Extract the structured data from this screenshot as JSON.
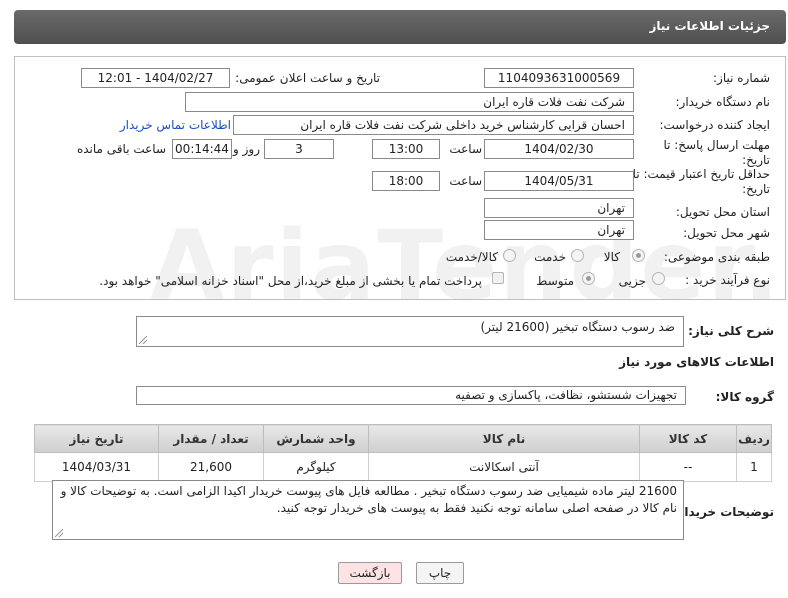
{
  "header": {
    "title": "جزئیات اطلاعات نیاز"
  },
  "form": {
    "need_number_label": "شماره نیاز:",
    "need_number": "1104093631000569",
    "announce_label": "تاریخ و ساعت اعلان عمومی:",
    "announce_value": "1404/02/27 - 12:01",
    "buyer_org_label": "نام دستگاه خریدار:",
    "buyer_org": "شرکت نفت فلات قاره ایران",
    "requester_label": "ایجاد کننده درخواست:",
    "requester": "احسان قرایی کارشناس خرید داخلی شرکت نفت فلات قاره ایران",
    "contact_link": "اطلاعات تماس خریدار",
    "deadline_label": "مهلت ارسال پاسخ: تا تاریخ:",
    "deadline_date": "1404/02/30",
    "time_label": "ساعت",
    "deadline_time": "13:00",
    "days_value": "3",
    "days_label": "روز و",
    "remaining_value": "00:14:44",
    "remaining_label": "ساعت باقی مانده",
    "price_valid_label": "حداقل تاریخ اعتبار قیمت: تا تاریخ:",
    "price_valid_date": "1404/05/31",
    "price_valid_time": "18:00",
    "province_label": "استان محل تحویل:",
    "province": "تهران",
    "city_label": "شهر محل تحویل:",
    "city": "تهران",
    "category_label": "طبقه بندی موضوعی:",
    "category_options": [
      "کالا",
      "خدمت",
      "کالا/خدمت"
    ],
    "process_label": "نوع فرآیند خرید :",
    "process_options": [
      "جزیی",
      "متوسط"
    ],
    "payment_note": "پرداخت تمام یا بخشی از مبلغ خرید،از محل \"اسناد خزانه اسلامی\" خواهد بود."
  },
  "summary": {
    "label": "شرح کلی نیاز:",
    "value": "ضد رسوب دستگاه تبخیر (21600 لیتر)"
  },
  "items_section": {
    "title": "اطلاعات کالاهای مورد نیاز",
    "group_label": "گروه کالا:",
    "group_value": "تجهیزات شستشو، نظافت، پاکسازی و تصفیه"
  },
  "table": {
    "headers": [
      "ردیف",
      "کد کالا",
      "نام کالا",
      "واحد شمارش",
      "تعداد / مقدار",
      "تاریخ نیاز"
    ],
    "rows": [
      [
        "1",
        "--",
        "آنتی اسکالانت",
        "کیلوگرم",
        "21,600",
        "1404/03/31"
      ]
    ]
  },
  "buyer_notes": {
    "label": "توضیحات خریدار:",
    "value": "21600 لیتر ماده شیمیایی ضد رسوب دستگاه تبخیر . مطالعه فایل های پیوست خریدار اکیدا الزامی است. به توضیحات کالا و نام کالا در صفحه اصلی سامانه توجه نکنید فقط به پیوست های خریدار توجه کنید."
  },
  "buttons": {
    "print": "چاپ",
    "back": "بازگشت"
  },
  "watermark": "AriaTender.neT",
  "colors": {
    "header_bg": "#5a5a5a",
    "link": "#1a4fbf",
    "back_button_bg": "#fde3e3"
  }
}
